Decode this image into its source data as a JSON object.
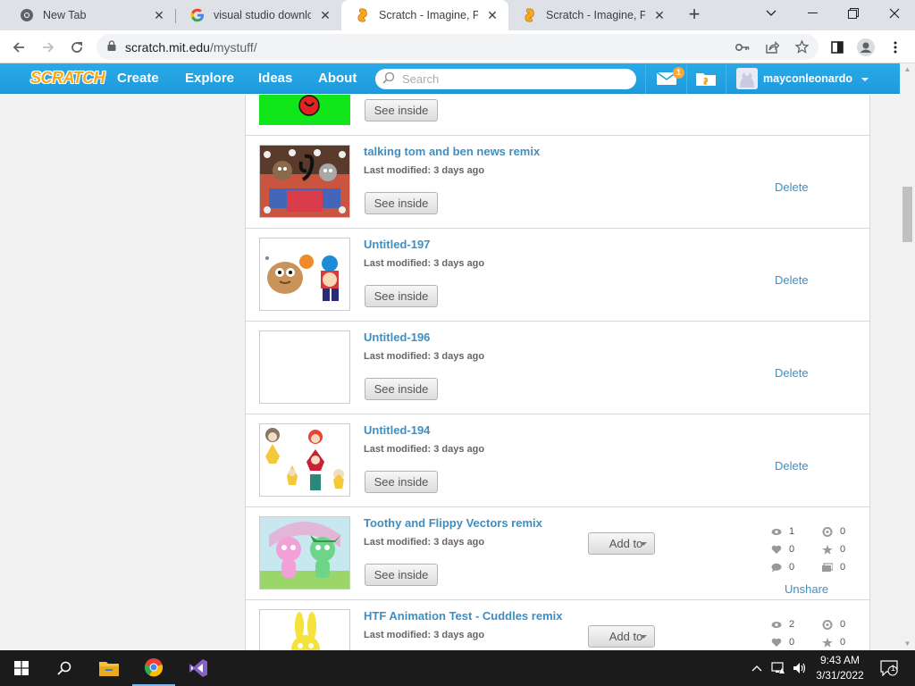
{
  "browser": {
    "tabs": [
      {
        "title": "New Tab",
        "active": false
      },
      {
        "title": "visual studio download",
        "active": false
      },
      {
        "title": "Scratch - Imagine, Program, Share",
        "active": true
      },
      {
        "title": "Scratch - Imagine, Program, Share",
        "active": false
      }
    ],
    "new_tab_label": "+",
    "url_host": "scratch.mit.edu",
    "url_path": "/mystuff/"
  },
  "scratch_nav": {
    "logo": "SCRATCH",
    "links": [
      "Create",
      "Explore",
      "Ideas",
      "About"
    ],
    "search_placeholder": "Search",
    "message_count": "1",
    "username": "mayconleonardo"
  },
  "projects": [
    {
      "title": "",
      "modified": "",
      "see_inside": "See inside",
      "action": "",
      "thumb": "green-phone"
    },
    {
      "title": "talking tom and ben news remix",
      "modified": "Last modified: 3 days ago",
      "see_inside": "See inside",
      "action": "Delete",
      "thumb": "tom-ben"
    },
    {
      "title": "Untitled-197",
      "modified": "Last modified: 3 days ago",
      "see_inside": "See inside",
      "action": "Delete",
      "thumb": "pou"
    },
    {
      "title": "Untitled-196",
      "modified": "Last modified: 3 days ago",
      "see_inside": "See inside",
      "action": "Delete",
      "thumb": "blank"
    },
    {
      "title": "Untitled-194",
      "modified": "Last modified: 3 days ago",
      "see_inside": "See inside",
      "action": "Delete",
      "thumb": "characters"
    },
    {
      "title": "Toothy and Flippy Vectors remix",
      "modified": "Last modified: 3 days ago",
      "see_inside": "See inside",
      "add_to": "Add to",
      "action": "Unshare",
      "thumb": "htf",
      "stats": {
        "views": "1",
        "loves": "0",
        "comments": "0",
        "remixes": "0",
        "favorites": "0",
        "studios": "0"
      }
    },
    {
      "title": "HTF Animation Test - Cuddles remix",
      "modified": "Last modified: 3 days ago",
      "add_to": "Add to",
      "thumb": "cuddles",
      "stats": {
        "views": "2",
        "loves": "0",
        "remixes": "0",
        "favorites": "0"
      }
    }
  ],
  "taskbar": {
    "time": "9:43 AM",
    "date": "3/31/2022",
    "notification_count": "1"
  },
  "colors": {
    "scratch_blue": "#1e9bdc",
    "link_blue": "#3e8ec2",
    "chrome_tabstrip": "#dee1e6",
    "taskbar": "#1b1b1b"
  }
}
